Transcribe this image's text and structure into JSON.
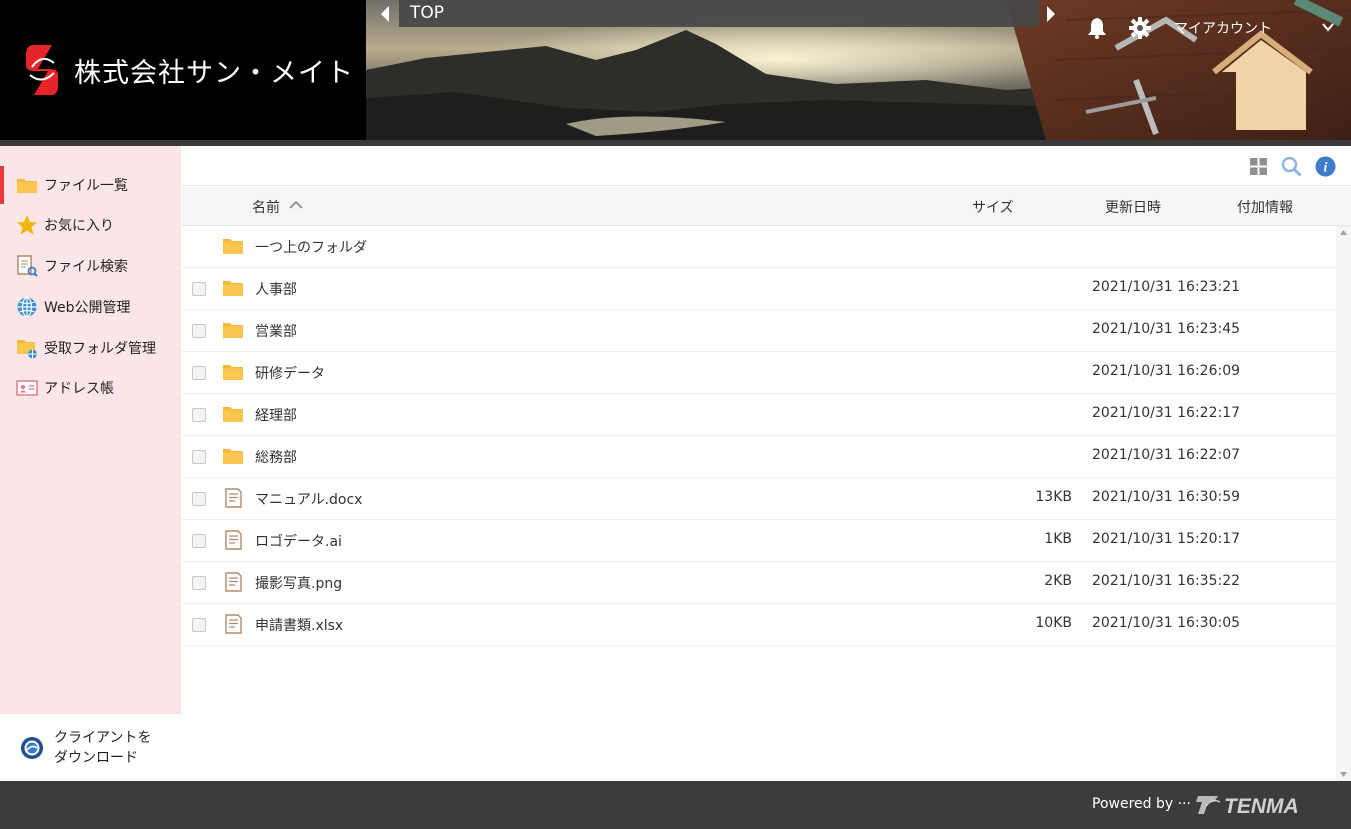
{
  "header": {
    "company_name": "株式会社サン・メイト",
    "breadcrumb": "TOP",
    "account_label": "マイアカウント",
    "brand_color": "#e8242b"
  },
  "sidebar": {
    "items": [
      {
        "label": "ファイル一覧",
        "icon": "folder-icon",
        "active": true
      },
      {
        "label": "お気に入り",
        "icon": "star-icon"
      },
      {
        "label": "ファイル検索",
        "icon": "file-search-icon"
      },
      {
        "label": "Web公開管理",
        "icon": "globe-icon"
      },
      {
        "label": "受取フォルダ管理",
        "icon": "receive-folder-icon"
      },
      {
        "label": "アドレス帳",
        "icon": "address-book-icon"
      }
    ],
    "client_download": {
      "line1": "クライアントを",
      "line2": "ダウンロード"
    }
  },
  "table": {
    "columns": {
      "name": "名前",
      "size": "サイズ",
      "date": "更新日時",
      "info": "付加情報"
    },
    "parent_folder": "一つ上のフォルダ",
    "rows": [
      {
        "name": "人事部",
        "type": "folder",
        "size": "",
        "date": "2021/10/31 16:23:21"
      },
      {
        "name": "営業部",
        "type": "folder",
        "size": "",
        "date": "2021/10/31 16:23:45"
      },
      {
        "name": "研修データ",
        "type": "folder",
        "size": "",
        "date": "2021/10/31 16:26:09"
      },
      {
        "name": "経理部",
        "type": "folder",
        "size": "",
        "date": "2021/10/31 16:22:17"
      },
      {
        "name": "総務部",
        "type": "folder",
        "size": "",
        "date": "2021/10/31 16:22:07"
      },
      {
        "name": "マニュアル.docx",
        "type": "file",
        "size": "13KB",
        "date": "2021/10/31 16:30:59"
      },
      {
        "name": "ロゴデータ.ai",
        "type": "file",
        "size": "1KB",
        "date": "2021/10/31 15:20:17"
      },
      {
        "name": "撮影写真.png",
        "type": "file",
        "size": "2KB",
        "date": "2021/10/31 16:35:22"
      },
      {
        "name": "申請書類.xlsx",
        "type": "file",
        "size": "10KB",
        "date": "2021/10/31 16:30:05"
      }
    ]
  },
  "footer": {
    "powered_by": "Powered by ···",
    "logo_text": "TENMA"
  }
}
